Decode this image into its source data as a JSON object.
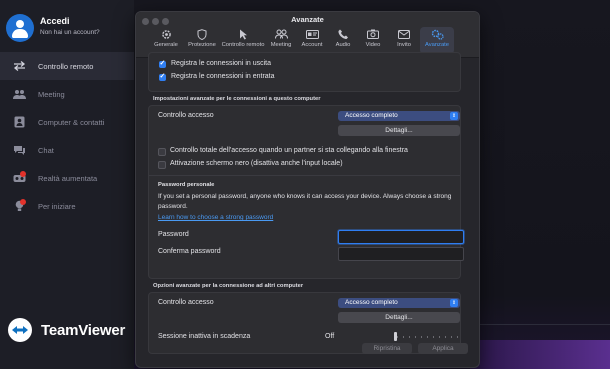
{
  "account": {
    "name": "Accedi",
    "subtitle": "Non hai un account?"
  },
  "sidebar": {
    "items": [
      {
        "label": "Controllo remoto",
        "icon": "arrows-icon",
        "active": true
      },
      {
        "label": "Meeting",
        "icon": "people-icon",
        "active": false
      },
      {
        "label": "Computer & contatti",
        "icon": "contacts-icon",
        "active": false
      },
      {
        "label": "Chat",
        "icon": "chat-icon",
        "active": false
      },
      {
        "label": "Realtà aumentata",
        "icon": "ar-glasses-icon",
        "active": false
      },
      {
        "label": "Per iniziare",
        "icon": "lightbulb-icon",
        "active": false
      }
    ],
    "brand": "TeamViewer"
  },
  "window": {
    "title": "Avanzate",
    "tabs": [
      {
        "label": "Generale",
        "icon": "gear-icon"
      },
      {
        "label": "Protezione",
        "icon": "shield-icon"
      },
      {
        "label": "Controllo remoto",
        "icon": "cursor-icon"
      },
      {
        "label": "Meeting",
        "icon": "people-icon"
      },
      {
        "label": "Account",
        "icon": "id-card-icon"
      },
      {
        "label": "Audio",
        "icon": "phone-icon"
      },
      {
        "label": "Video",
        "icon": "camera-icon"
      },
      {
        "label": "Invito",
        "icon": "envelope-icon"
      },
      {
        "label": "Avanzate",
        "icon": "gears-icon",
        "active": true
      }
    ]
  },
  "logging": {
    "outgoing": {
      "label": "Registra le connessioni in uscita",
      "checked": true
    },
    "incoming": {
      "label": "Registra le connessioni in entrata",
      "checked": true
    }
  },
  "incoming_section": {
    "header": "Impostazioni avanzate per le connessioni a questo computer",
    "access_label": "Controllo accesso",
    "access_value": "Accesso completo",
    "details_button": "Dettagli...",
    "full_control": {
      "label": "Controllo totale dell'accesso quando un partner si sta collegando alla finestra",
      "checked": false
    },
    "black_screen": {
      "label": "Attivazione schermo nero (disattiva anche l'input locale)",
      "checked": false
    }
  },
  "personal_password": {
    "header": "Password personale",
    "description": "If you set a personal password, anyone who knows it can access your device. Always choose a strong password.",
    "link": "Learn how to choose a strong password",
    "password_label": "Password",
    "password_value": "",
    "confirm_label": "Conferma password",
    "confirm_value": ""
  },
  "outgoing_section": {
    "header": "Opzioni avanzate per la connessione ad altri computer",
    "access_label": "Controllo accesso",
    "access_value": "Accesso completo",
    "details_button": "Dettagli...",
    "timeout_label": "Sessione inattiva in scadenza",
    "timeout_value": "Off"
  },
  "footer": {
    "restore": "Ripristina",
    "apply": "Applica"
  },
  "colors": {
    "accent": "#2f7ef2",
    "brand_blue": "#1f6fd1",
    "alert": "#e2322b"
  }
}
